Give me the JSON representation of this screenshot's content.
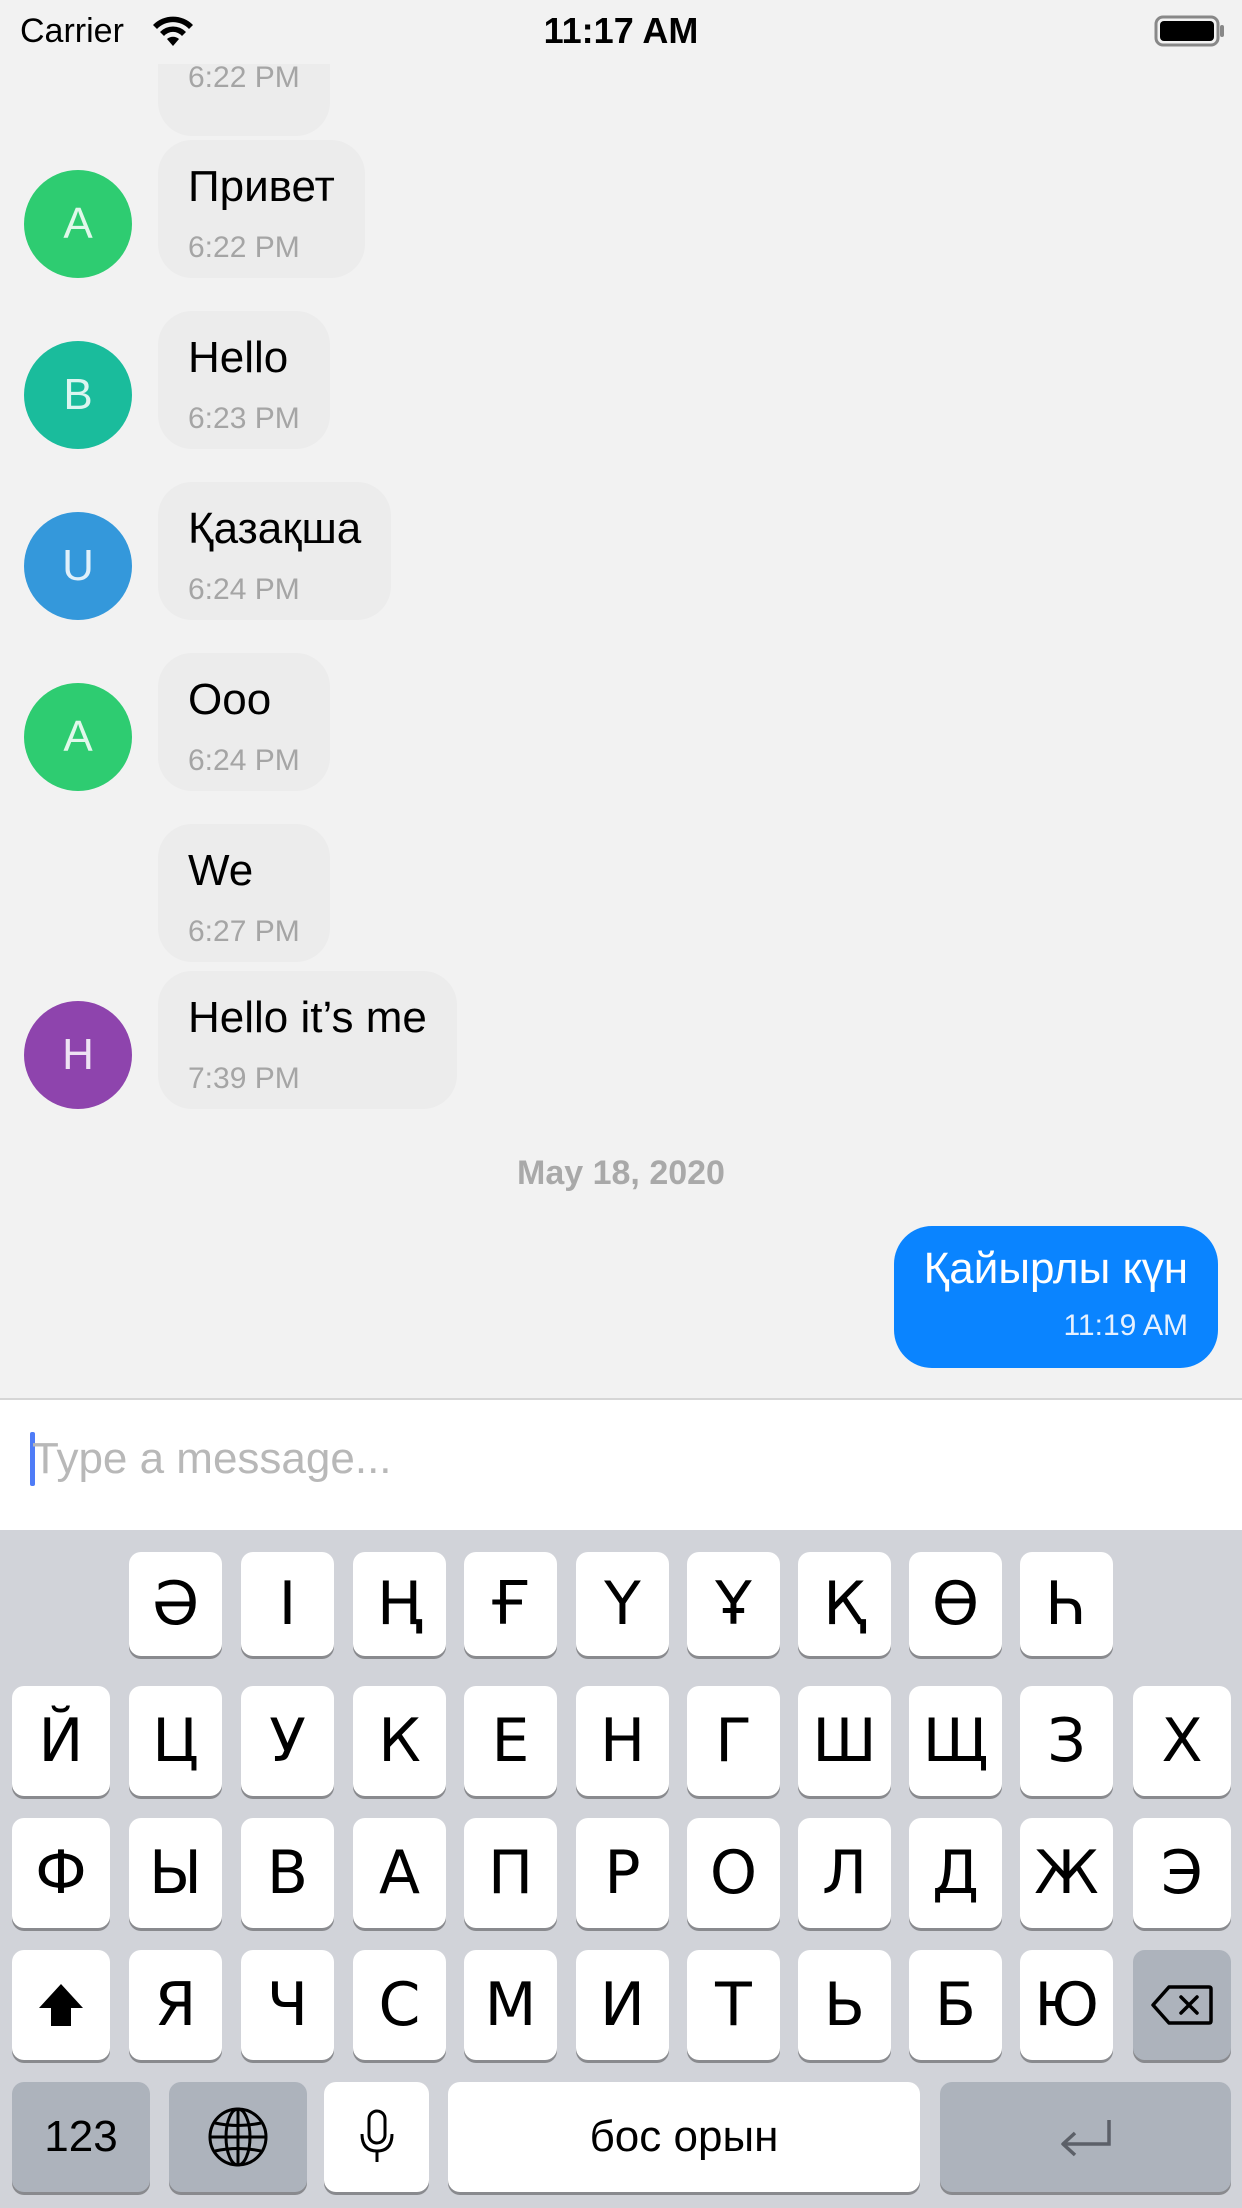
{
  "status_bar": {
    "carrier": "Carrier",
    "time": "11:17 AM",
    "icons": [
      "wifi-icon",
      "battery-icon"
    ]
  },
  "chat": {
    "messages": [
      {
        "time": "6:22 PM"
      },
      {
        "avatar": "A",
        "text": "Привет",
        "time": "6:22 PM",
        "avatar_color": "#2ecc71"
      },
      {
        "avatar": "B",
        "text": "Hello",
        "time": "6:23 PM",
        "avatar_color": "#1abc9c"
      },
      {
        "avatar": "U",
        "text": "Қазақша",
        "time": "6:24 PM",
        "avatar_color": "#3498db"
      },
      {
        "avatar": "A",
        "text": "Ооо",
        "time": "6:24 PM",
        "avatar_color": "#2ecc71"
      },
      {
        "text": "We",
        "time": "6:27 PM"
      },
      {
        "avatar": "H",
        "text": "Hello it’s me",
        "time": "7:39 PM",
        "avatar_color": "#8e44ad"
      }
    ],
    "date_separator": "May 18, 2020",
    "outgoing": {
      "text": "Қайырлы күн",
      "time": "11:19 AM",
      "color": "#0a84ff"
    }
  },
  "composer": {
    "placeholder": "Type a message...",
    "value": ""
  },
  "keyboard": {
    "row1": [
      "Ә",
      "І",
      "Ң",
      "Ғ",
      "Ү",
      "Ұ",
      "Қ",
      "Ө",
      "Һ"
    ],
    "row2": [
      "Й",
      "Ц",
      "У",
      "К",
      "Е",
      "Н",
      "Г",
      "Ш",
      "Щ",
      "З",
      "Х"
    ],
    "row3": [
      "Ф",
      "Ы",
      "В",
      "А",
      "П",
      "Р",
      "О",
      "Л",
      "Д",
      "Ж",
      "Э"
    ],
    "row4": [
      "Я",
      "Ч",
      "С",
      "М",
      "И",
      "Т",
      "Ь",
      "Б",
      "Ю"
    ],
    "numbers_label": "123",
    "space_label": "бос орын",
    "icons": [
      "shift-icon",
      "backspace-icon",
      "globe-icon",
      "microphone-icon",
      "return-icon"
    ]
  }
}
